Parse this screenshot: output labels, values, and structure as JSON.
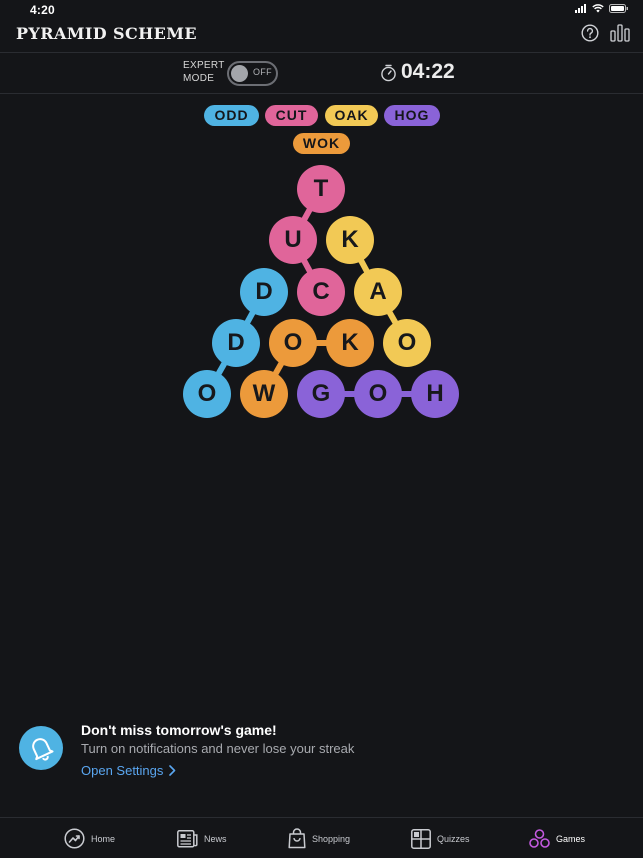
{
  "status": {
    "time": "4:20"
  },
  "header": {
    "title": "PYRAMID SCHEME",
    "help_icon": "question-circle-icon",
    "stats_icon": "bar-chart-icon"
  },
  "toolbar": {
    "expert_label_line1": "EXPERT",
    "expert_label_line2": "MODE",
    "toggle_state": "OFF",
    "timer": "04:22"
  },
  "colors": {
    "blue": "#4fb3e3",
    "pink": "#e0659a",
    "yellow": "#f2c955",
    "orange": "#ec9a3b",
    "purple": "#8a63d8",
    "link": "#5aa6f0"
  },
  "found_words": [
    {
      "word": "ODD",
      "color": "blue"
    },
    {
      "word": "CUT",
      "color": "pink"
    },
    {
      "word": "OAK",
      "color": "yellow"
    },
    {
      "word": "HOG",
      "color": "purple"
    },
    {
      "word": "WOK",
      "color": "orange"
    }
  ],
  "pyramid": {
    "rows": [
      [
        {
          "letter": "T",
          "color": "pink"
        }
      ],
      [
        {
          "letter": "U",
          "color": "pink"
        },
        {
          "letter": "K",
          "color": "yellow"
        }
      ],
      [
        {
          "letter": "D",
          "color": "blue"
        },
        {
          "letter": "C",
          "color": "pink"
        },
        {
          "letter": "A",
          "color": "yellow"
        }
      ],
      [
        {
          "letter": "D",
          "color": "blue"
        },
        {
          "letter": "O",
          "color": "orange"
        },
        {
          "letter": "K",
          "color": "orange"
        },
        {
          "letter": "O",
          "color": "yellow"
        }
      ],
      [
        {
          "letter": "O",
          "color": "blue"
        },
        {
          "letter": "W",
          "color": "orange"
        },
        {
          "letter": "G",
          "color": "purple"
        },
        {
          "letter": "O",
          "color": "purple"
        },
        {
          "letter": "H",
          "color": "purple"
        }
      ]
    ]
  },
  "notification": {
    "title": "Don't miss tomorrow's game!",
    "description": "Turn on notifications and never lose your streak",
    "link": "Open Settings"
  },
  "tabs": [
    {
      "label": "Home",
      "icon": "trending-up-icon",
      "active": false
    },
    {
      "label": "News",
      "icon": "newspaper-icon",
      "active": false
    },
    {
      "label": "Shopping",
      "icon": "shopping-bag-icon",
      "active": false
    },
    {
      "label": "Quizzes",
      "icon": "quiz-grid-icon",
      "active": false
    },
    {
      "label": "Games",
      "icon": "games-icon",
      "active": true
    }
  ]
}
